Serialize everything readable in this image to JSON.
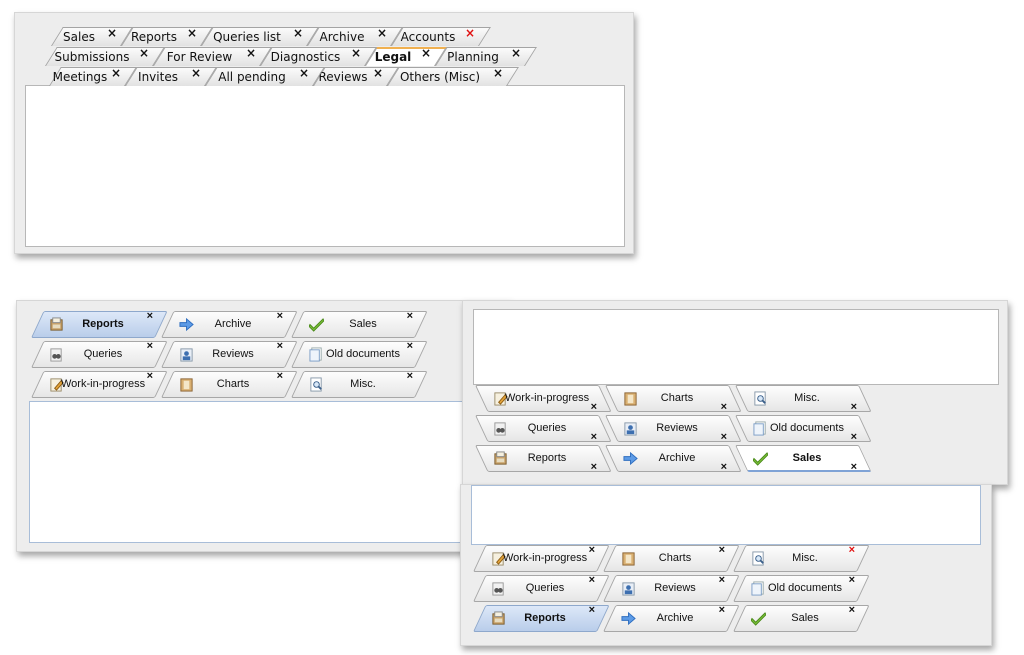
{
  "panel1": {
    "rows": [
      [
        {
          "label": "Sales"
        },
        {
          "label": "Reports"
        },
        {
          "label": "Queries list"
        },
        {
          "label": "Archive"
        },
        {
          "label": "Accounts",
          "close_red": true
        }
      ],
      [
        {
          "label": "Submissions"
        },
        {
          "label": "For Review"
        },
        {
          "label": "Diagnostics"
        },
        {
          "label": "Legal",
          "active": true
        },
        {
          "label": "Planning"
        }
      ],
      [
        {
          "label": "Meetings"
        },
        {
          "label": "Invites"
        },
        {
          "label": "All pending"
        },
        {
          "label": "Reviews"
        },
        {
          "label": "Others (Misc)"
        }
      ]
    ],
    "close_glyph": "×"
  },
  "panel2": {
    "rows": [
      [
        {
          "label": "Reports",
          "icon": "reports-icon",
          "bold": true,
          "selected": true
        },
        {
          "label": "Archive",
          "icon": "arrow-right-icon"
        },
        {
          "label": "Sales",
          "icon": "checkmark-icon"
        }
      ],
      [
        {
          "label": "Queries",
          "icon": "binoculars-icon"
        },
        {
          "label": "Reviews",
          "icon": "user-card-icon"
        },
        {
          "label": "Old documents",
          "icon": "documents-icon"
        }
      ],
      [
        {
          "label": "Work-in-progress",
          "icon": "pencil-note-icon"
        },
        {
          "label": "Charts",
          "icon": "chart-book-icon"
        },
        {
          "label": "Misc.",
          "icon": "magnifier-doc-icon"
        }
      ]
    ]
  },
  "panel3": {
    "rows": [
      [
        {
          "label": "Work-in-progress",
          "icon": "pencil-note-icon"
        },
        {
          "label": "Charts",
          "icon": "chart-book-icon"
        },
        {
          "label": "Misc.",
          "icon": "magnifier-doc-icon"
        }
      ],
      [
        {
          "label": "Queries",
          "icon": "binoculars-icon"
        },
        {
          "label": "Reviews",
          "icon": "user-card-icon"
        },
        {
          "label": "Old documents",
          "icon": "documents-icon"
        }
      ],
      [
        {
          "label": "Reports",
          "icon": "reports-icon"
        },
        {
          "label": "Archive",
          "icon": "arrow-right-icon"
        },
        {
          "label": "Sales",
          "icon": "checkmark-icon",
          "bold": true,
          "selected_white": true
        }
      ]
    ]
  },
  "panel4": {
    "rows": [
      [
        {
          "label": "Work-in-progress",
          "icon": "pencil-note-icon"
        },
        {
          "label": "Charts",
          "icon": "chart-book-icon"
        },
        {
          "label": "Misc.",
          "icon": "magnifier-doc-icon",
          "close_red": true
        }
      ],
      [
        {
          "label": "Queries",
          "icon": "binoculars-icon"
        },
        {
          "label": "Reviews",
          "icon": "user-card-icon"
        },
        {
          "label": "Old documents",
          "icon": "documents-icon"
        }
      ],
      [
        {
          "label": "Reports",
          "icon": "reports-icon",
          "bold": true,
          "selected": true
        },
        {
          "label": "Archive",
          "icon": "arrow-right-icon"
        },
        {
          "label": "Sales",
          "icon": "checkmark-icon"
        }
      ]
    ]
  }
}
